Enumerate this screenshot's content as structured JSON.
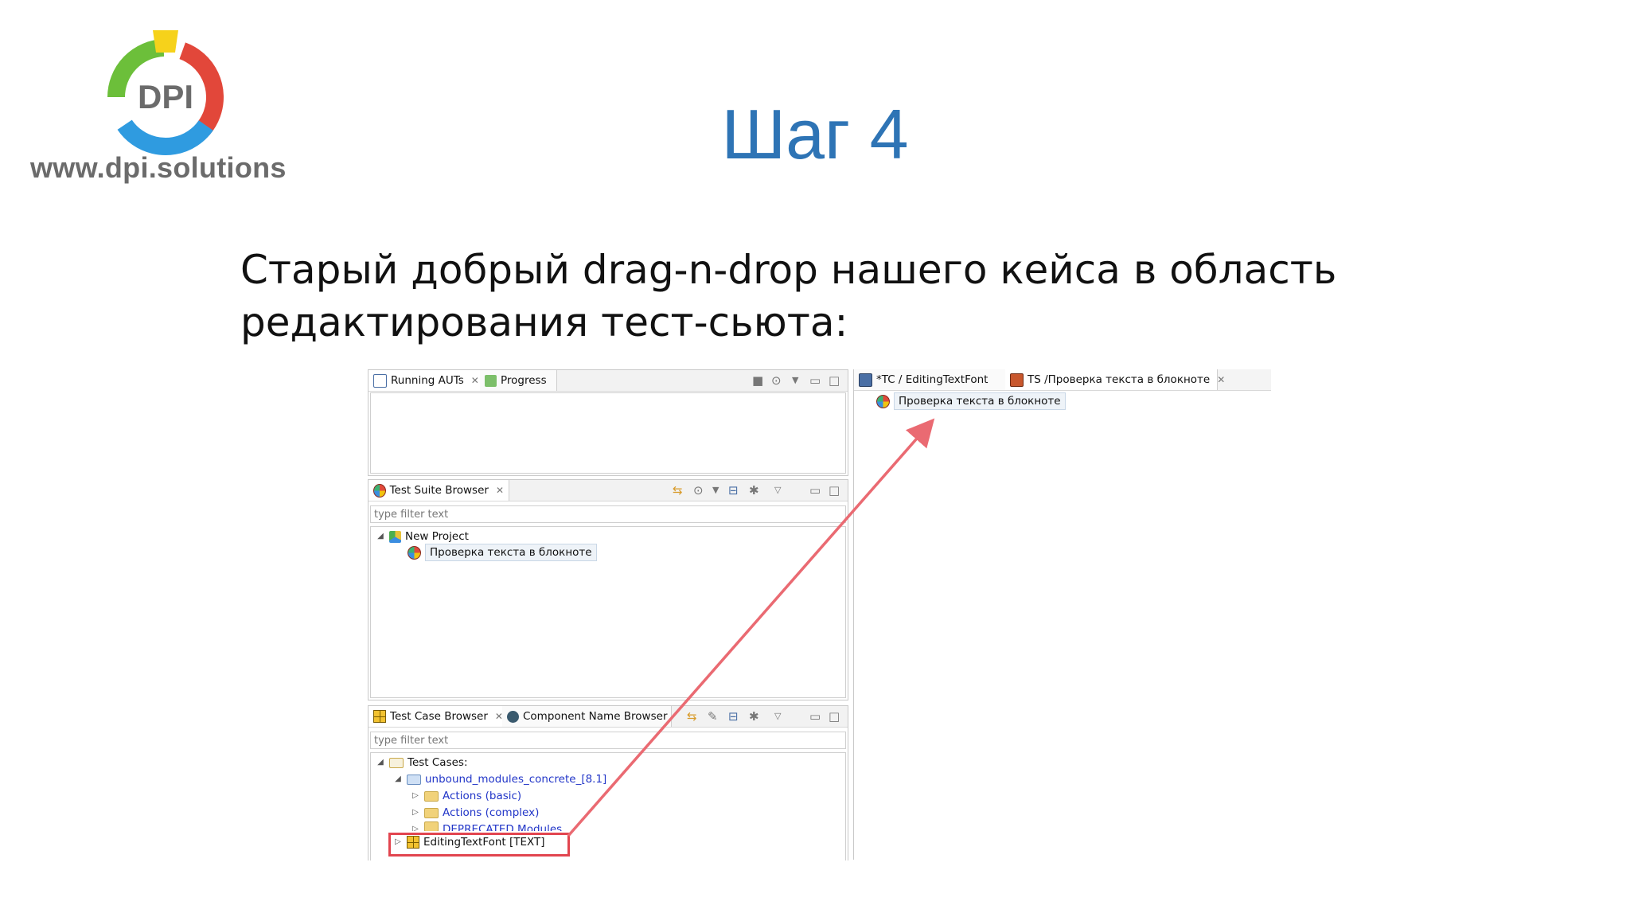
{
  "logo": {
    "text": "DPI",
    "url": "www.dpi.solutions"
  },
  "slide": {
    "title": "Шаг 4",
    "body_line1": "Старый добрый drag-n-drop нашего кейса в область",
    "body_line2": "редактирования тест-сьюта:"
  },
  "ide": {
    "running_auts_pane": {
      "tabs": [
        {
          "label": "Running AUTs",
          "closable": true
        },
        {
          "label": "Progress"
        }
      ]
    },
    "test_suite_browser": {
      "tab_label": "Test Suite Browser",
      "filter_placeholder": "type filter text",
      "tree": [
        {
          "label": "New Project",
          "expanded": true,
          "level": 0
        },
        {
          "label": "Проверка текста в блокноте",
          "level": 1
        }
      ]
    },
    "test_case_browser": {
      "tabs": [
        {
          "label": "Test Case Browser",
          "closable": true
        },
        {
          "label": "Component Name Browser"
        }
      ],
      "filter_placeholder": "type filter text",
      "tree": [
        {
          "label": "Test Cases:",
          "expanded": true,
          "level": 0
        },
        {
          "label": "unbound_modules_concrete_[8.1]",
          "expanded": true,
          "level": 1
        },
        {
          "label": "Actions (basic)",
          "level": 2
        },
        {
          "label": "Actions (complex)",
          "level": 2
        },
        {
          "label": "DEPRECATED Modules",
          "level": 2
        },
        {
          "label": "EditingTextFont [TEXT]",
          "level": 1,
          "highlighted": true
        }
      ]
    },
    "editor": {
      "tabs": [
        {
          "label": "*TC / EditingTextFont"
        },
        {
          "label": "TS /Проверка текста в блокноте",
          "closable": true,
          "active": true
        }
      ],
      "root_item": "Проверка текста в блокноте"
    },
    "colors": {
      "title_blue": "#2e74b5",
      "arrow": "#ea6a72",
      "highlight": "#e2454f",
      "logo_green": "#6cbf3a",
      "logo_red": "#e2473a",
      "logo_blue": "#2f9be0",
      "logo_yellow": "#f6d21b"
    }
  }
}
